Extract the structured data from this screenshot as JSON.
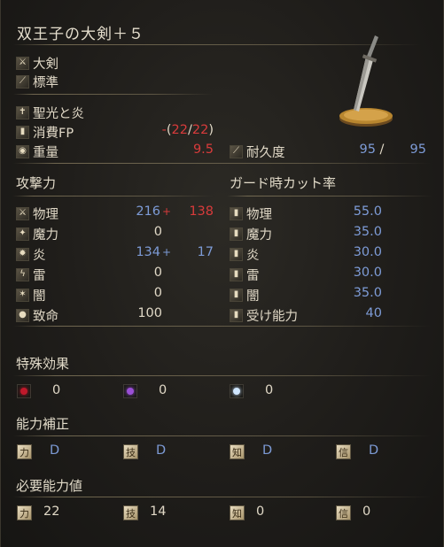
{
  "weapon": {
    "name": "双王子の大剣＋５",
    "type": "大剣",
    "attack_type": "標準",
    "skill": "聖光と炎",
    "fp_label": "消費FP",
    "fp_prefix": "-",
    "fp_open": "(",
    "fp_a": "22",
    "fp_sep": "/",
    "fp_b": "22",
    "fp_close": ")",
    "weight_label": "重量",
    "weight": "9.5",
    "durability_label": "耐久度",
    "durability_cur": "95",
    "durability_sep": "/",
    "durability_max": "95"
  },
  "attack": {
    "title": "攻撃力",
    "rows": [
      {
        "label": "物理",
        "base": "216",
        "plus": "+",
        "bonus": "138",
        "bonus_color": "red"
      },
      {
        "label": "魔力",
        "base": "0",
        "plus": "",
        "bonus": "",
        "bonus_color": ""
      },
      {
        "label": "炎",
        "base": "134",
        "plus": "+",
        "bonus": "17",
        "bonus_color": "blue"
      },
      {
        "label": "雷",
        "base": "0",
        "plus": "",
        "bonus": "",
        "bonus_color": ""
      },
      {
        "label": "闇",
        "base": "0",
        "plus": "",
        "bonus": "",
        "bonus_color": ""
      },
      {
        "label": "致命",
        "base": "100",
        "plus": "",
        "bonus": "",
        "bonus_color": ""
      }
    ]
  },
  "guard": {
    "title": "ガード時カット率",
    "rows": [
      {
        "label": "物理",
        "value": "55.0"
      },
      {
        "label": "魔力",
        "value": "35.0"
      },
      {
        "label": "炎",
        "value": "30.0"
      },
      {
        "label": "雷",
        "value": "30.0"
      },
      {
        "label": "闇",
        "value": "35.0"
      },
      {
        "label": "受け能力",
        "value": "40"
      }
    ]
  },
  "effects": {
    "title": "特殊効果",
    "items": [
      {
        "icon": "bleed-icon",
        "color": "#c0192b",
        "value": "0"
      },
      {
        "icon": "poison-icon",
        "color": "#9a4fd6",
        "value": "0"
      },
      {
        "icon": "frost-icon",
        "color": "#cfe6ff",
        "value": "0"
      }
    ]
  },
  "scaling": {
    "title": "能力補正",
    "items": [
      {
        "icon": "strength-icon",
        "glyph": "力",
        "value": "D"
      },
      {
        "icon": "dexterity-icon",
        "glyph": "技",
        "value": "D"
      },
      {
        "icon": "intelligence-icon",
        "glyph": "知",
        "value": "D"
      },
      {
        "icon": "faith-icon",
        "glyph": "信",
        "value": "D"
      }
    ]
  },
  "requirements": {
    "title": "必要能力値",
    "items": [
      {
        "icon": "strength-icon",
        "glyph": "力",
        "value": "22"
      },
      {
        "icon": "dexterity-icon",
        "glyph": "技",
        "value": "14"
      },
      {
        "icon": "intelligence-icon",
        "glyph": "知",
        "value": "0"
      },
      {
        "icon": "faith-icon",
        "glyph": "信",
        "value": "0"
      }
    ]
  },
  "colors": {
    "blue": "#7d9bd6",
    "red": "#d83b3b",
    "text": "#e0d8c6"
  }
}
